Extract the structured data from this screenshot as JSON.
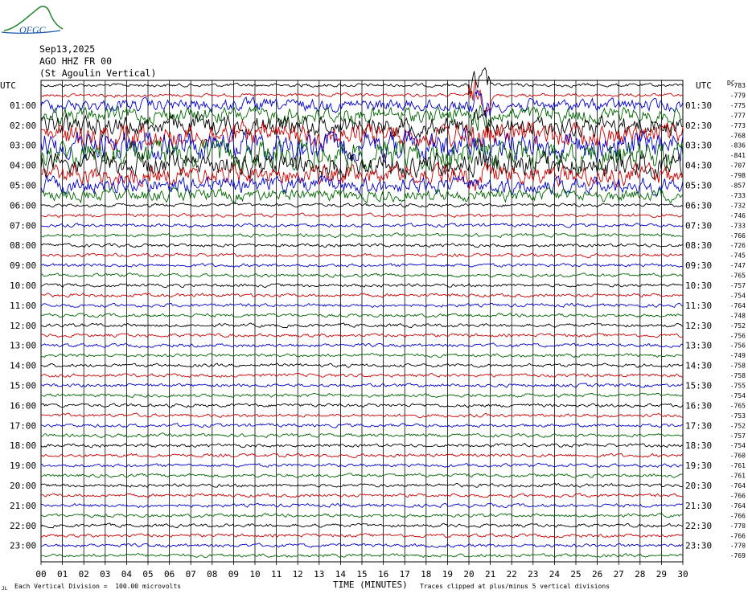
{
  "logo": {
    "text": "OFGC",
    "icon": "mountain-logo-icon"
  },
  "header": {
    "date": "Sep13,2025",
    "station": "AGO HHZ FR 00",
    "station_name": "(St Agoulin Vertical)"
  },
  "footer": {
    "scale_note": "Each Vertical Division =  100.00 microvolts",
    "clip_note": "Traces clipped at plus/minus 5 vertical divisions",
    "corner_mark": "JL"
  },
  "colors": {
    "trace_cycle": [
      "#000000",
      "#cc0000",
      "#0000cc",
      "#006600"
    ],
    "grid": "#000000"
  },
  "chart_data": {
    "type": "line",
    "plot_kind": "helicorder",
    "xlabel": "TIME (MINUTES)",
    "x_ticks": [
      "00",
      "01",
      "02",
      "03",
      "04",
      "05",
      "06",
      "07",
      "08",
      "09",
      "10",
      "11",
      "12",
      "13",
      "14",
      "15",
      "16",
      "17",
      "18",
      "19",
      "20",
      "21",
      "22",
      "23",
      "24",
      "25",
      "26",
      "27",
      "28",
      "29",
      "30"
    ],
    "xlim": [
      0,
      30
    ],
    "left_axis_title": "UTC",
    "right_axis_title": "UTC",
    "dc_header": "DC",
    "left_labels": [
      "01:00",
      "02:00",
      "03:00",
      "04:00",
      "05:00",
      "06:00",
      "07:00",
      "08:00",
      "09:00",
      "10:00",
      "11:00",
      "12:00",
      "13:00",
      "14:00",
      "15:00",
      "16:00",
      "17:00",
      "18:00",
      "19:00",
      "20:00",
      "21:00",
      "22:00",
      "23:00"
    ],
    "right_labels": [
      "01:30",
      "02:30",
      "03:30",
      "04:30",
      "05:30",
      "06:30",
      "07:30",
      "08:30",
      "09:30",
      "10:30",
      "11:30",
      "12:30",
      "13:30",
      "14:30",
      "15:30",
      "16:30",
      "17:30",
      "18:30",
      "19:30",
      "20:30",
      "21:30",
      "22:30",
      "23:30"
    ],
    "dc_offsets": [
      "-783",
      "-779",
      "-775",
      "-777",
      "-773",
      "-768",
      "-836",
      "-841",
      "-707",
      "-798",
      "-857",
      "-733",
      "-732",
      "-746",
      "-733",
      "-766",
      "-726",
      "-745",
      "-747",
      "-765",
      "-757",
      "-754",
      "-764",
      "-748",
      "-752",
      "-756",
      "-756",
      "-749",
      "-758",
      "-758",
      "-755",
      "-754",
      "-765",
      "-753",
      "-752",
      "-757",
      "-754",
      "-760",
      "-761",
      "-761",
      "-764",
      "-766",
      "-764",
      "-766",
      "-770",
      "-766",
      "-770",
      "-769"
    ],
    "trace_count": 48,
    "minutes_per_trace": 30,
    "events": [
      {
        "label": "seismic activity",
        "start_minute": 0,
        "end_minute": 30,
        "first_trace": 2,
        "last_trace": 11
      },
      {
        "label": "local burst",
        "start_minute": 20,
        "end_minute": 21,
        "first_trace": 0,
        "last_trace": 9
      }
    ]
  }
}
